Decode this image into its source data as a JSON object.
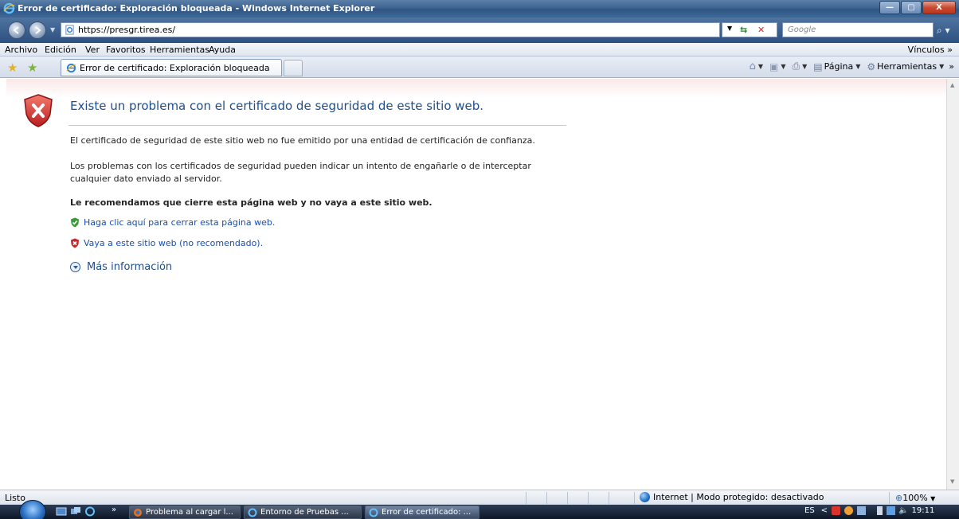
{
  "window": {
    "title": "Error de certificado: Exploración bloqueada - Windows Internet Explorer",
    "controls": {
      "minimize": "—",
      "maximize": "▢",
      "close": "X"
    }
  },
  "address": {
    "url": "https://presgr.tirea.es/",
    "search_placeholder": "Google"
  },
  "menu": {
    "items": [
      "Archivo",
      "Edición",
      "Ver",
      "Favoritos",
      "Herramientas",
      "Ayuda"
    ],
    "links_label": "Vínculos"
  },
  "tab": {
    "label": "Error de certificado: Exploración bloqueada"
  },
  "commands": {
    "page": "Página",
    "tools": "Herramientas"
  },
  "error_page": {
    "title": "Existe un problema con el certificado de seguridad de este sitio web.",
    "paragraph1": "El certificado de seguridad de este sitio web no fue emitido por una entidad de certificación de confianza.",
    "paragraph2": "Los problemas con los certificados de seguridad pueden indicar un intento de engañarle o de interceptar cualquier dato enviado al servidor.",
    "recommendation": "Le recomendamos que cierre esta página web y no vaya a este sitio web.",
    "close_link": "Haga clic aquí para cerrar esta página web.",
    "continue_link": "Vaya a este sitio web (no recomendado).",
    "more_info": "Más información"
  },
  "status": {
    "text": "Listo",
    "zone": "Internet | Modo protegido: desactivado",
    "zoom": "100%"
  },
  "taskbar": {
    "chevron": "»",
    "buttons": [
      "Problema al cargar l...",
      "Entorno de Pruebas ...",
      "Error de certificado: ..."
    ],
    "language": "ES",
    "clock": "19:11"
  },
  "colors": {
    "link": "#1a4ea8",
    "title": "#1f4e8c",
    "error_red": "#c8262b",
    "ok_green": "#3a9b3a"
  }
}
